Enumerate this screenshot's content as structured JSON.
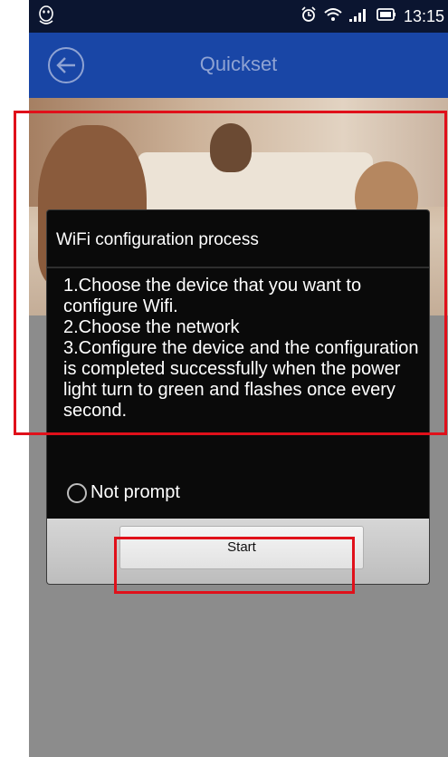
{
  "status_bar": {
    "time": "13:15",
    "icons": [
      "qq-penguin-icon",
      "alarm-icon",
      "wifi-icon",
      "signal-icon",
      "battery-icon"
    ]
  },
  "app_bar": {
    "title": "Quickset",
    "back_icon": "back-arrow-icon"
  },
  "dialog": {
    "title": "WiFi configuration process",
    "steps": [
      "1.Choose the device that you want to configure Wifi.",
      "2.Choose the network",
      "3.Configure the device and the configuration is completed successfully when the power light turn to green and flashes once every second."
    ],
    "not_prompt_label": "Not prompt",
    "start_label": "Start"
  },
  "colors": {
    "status_bar_bg": "#0b1530",
    "app_bar_bg": "#1946a6",
    "title_color": "#8fa3d3",
    "highlight": "#e0101a"
  }
}
